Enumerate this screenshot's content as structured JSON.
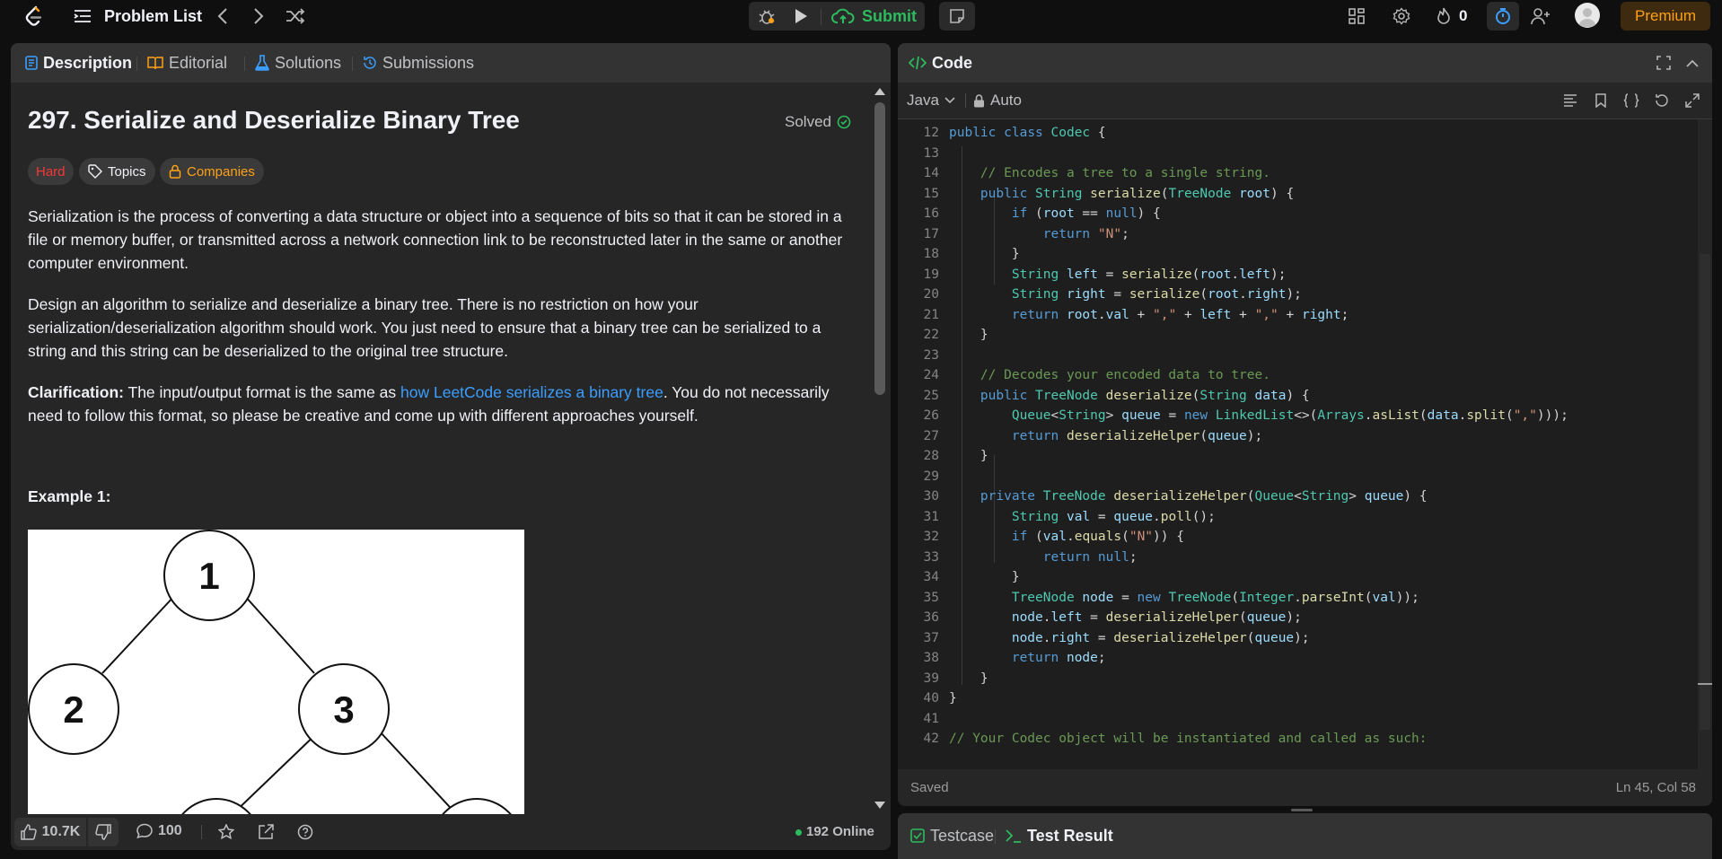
{
  "nav": {
    "problem_list_label": "Problem List",
    "submit_label": "Submit",
    "streak_count": "0",
    "premium_label": "Premium"
  },
  "left_tabs": {
    "description": "Description",
    "editorial": "Editorial",
    "solutions": "Solutions",
    "submissions": "Submissions"
  },
  "problem": {
    "title": "297. Serialize and Deserialize Binary Tree",
    "solved_label": "Solved",
    "tags": {
      "difficulty": "Hard",
      "topics": "Topics",
      "companies": "Companies"
    },
    "paragraph1": "Serialization is the process of converting a data structure or object into a sequence of bits so that it can be stored in a file or memory buffer, or transmitted across a network connection link to be reconstructed later in the same or another computer environment.",
    "paragraph2": "Design an algorithm to serialize and deserialize a binary tree. There is no restriction on how your serialization/deserialization algorithm should work. You just need to ensure that a binary tree can be serialized to a string and this string can be deserialized to the original tree structure.",
    "clarification_label": "Clarification:",
    "clarification_text_before": " The input/output format is the same as ",
    "clarification_link": "how LeetCode serializes a binary tree",
    "clarification_text_after": ". You do not necessarily need to follow this format, so please be creative and come up with different approaches yourself.",
    "example1_label": "Example 1:",
    "tree_nodes": [
      "1",
      "2",
      "3"
    ]
  },
  "left_footer": {
    "likes": "10.7K",
    "comments": "100",
    "online": "192 Online"
  },
  "code_panel": {
    "title": "Code",
    "language": "Java",
    "mode": "Auto",
    "status": "Saved",
    "cursor": "Ln 45, Col 58",
    "line_numbers": [
      "12",
      "13",
      "14",
      "15",
      "16",
      "17",
      "18",
      "19",
      "20",
      "21",
      "22",
      "23",
      "24",
      "25",
      "26",
      "27",
      "28",
      "29",
      "30",
      "31",
      "32",
      "33",
      "34",
      "35",
      "36",
      "37",
      "38",
      "39",
      "40",
      "41",
      "42"
    ],
    "lines": [
      "public class Codec {",
      "",
      "    // Encodes a tree to a single string.",
      "    public String serialize(TreeNode root) {",
      "        if (root == null) {",
      "            return \"N\";",
      "        }",
      "        String left = serialize(root.left);",
      "        String right = serialize(root.right);",
      "        return root.val + \",\" + left + \",\" + right;",
      "    }",
      "",
      "    // Decodes your encoded data to tree.",
      "    public TreeNode deserialize(String data) {",
      "        Queue<String> queue = new LinkedList<>(Arrays.asList(data.split(\",\")));",
      "        return deserializeHelper(queue);",
      "    }",
      "",
      "    private TreeNode deserializeHelper(Queue<String> queue) {",
      "        String val = queue.poll();",
      "        if (val.equals(\"N\")) {",
      "            return null;",
      "        }",
      "        TreeNode node = new TreeNode(Integer.parseInt(val));",
      "        node.left = deserializeHelper(queue);",
      "        node.right = deserializeHelper(queue);",
      "        return node;",
      "    }",
      "}",
      "",
      "// Your Codec object will be instantiated and called as such:"
    ]
  },
  "bottom_panel": {
    "testcase_label": "Testcase",
    "result_label": "Test Result"
  }
}
